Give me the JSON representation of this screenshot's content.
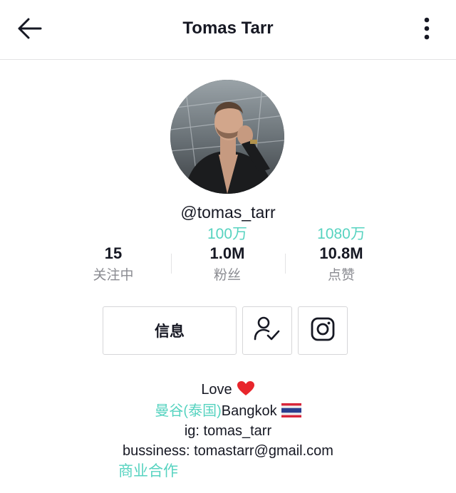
{
  "header": {
    "title": "Tomas Tarr"
  },
  "profile": {
    "username": "@tomas_tarr"
  },
  "stats": [
    {
      "value": "15",
      "label": "关注中",
      "annotation": ""
    },
    {
      "value": "1.0M",
      "label": "粉丝",
      "annotation": "100万"
    },
    {
      "value": "10.8M",
      "label": "点赞",
      "annotation": "1080万"
    }
  ],
  "actions": {
    "info_label": "信息"
  },
  "bio": {
    "line1_text": "Love",
    "line2_annotation": "曼谷(泰国)",
    "line2_text": "Bangkok",
    "line3_text": "ig: tomas_tarr",
    "line4_text": "bussiness: tomastarr@gmail.com",
    "line5_annotation": "商业合作"
  },
  "colors": {
    "annotation": "#57d3c0",
    "text_primary": "#161823",
    "text_secondary": "#8a8b91",
    "border": "#d6d6d8",
    "heart": "#e8262c"
  },
  "icons": {
    "back": "arrow-left-icon",
    "more": "more-vertical-icon",
    "friend": "user-check-icon",
    "instagram": "instagram-icon",
    "heart": "heart-icon",
    "flag": "thailand-flag-icon"
  }
}
